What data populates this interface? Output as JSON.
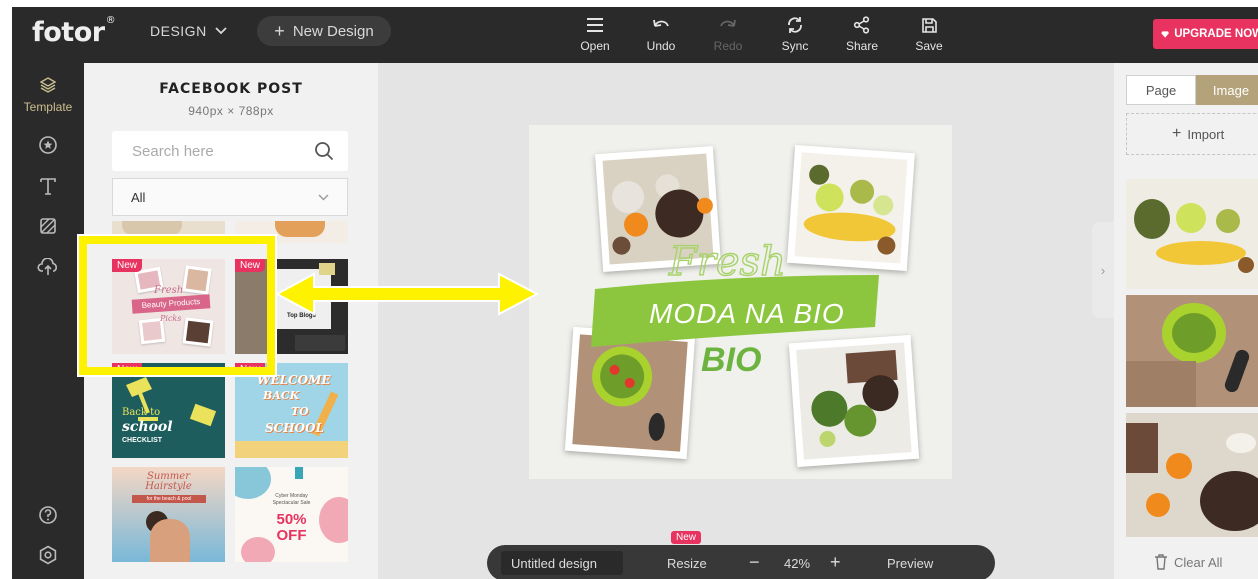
{
  "topbar": {
    "logo": "fotor",
    "logo_mark": "®",
    "design_menu": "DESIGN",
    "new_design": "New Design",
    "tools": [
      {
        "label": "Open",
        "icon": "menu-icon",
        "enabled": true
      },
      {
        "label": "Undo",
        "icon": "undo-icon",
        "enabled": true
      },
      {
        "label": "Redo",
        "icon": "redo-icon",
        "enabled": false
      },
      {
        "label": "Sync",
        "icon": "sync-icon",
        "enabled": true
      },
      {
        "label": "Share",
        "icon": "share-icon",
        "enabled": true
      },
      {
        "label": "Save",
        "icon": "save-icon",
        "enabled": true
      }
    ],
    "upgrade": "UPGRADE NOW"
  },
  "rail": {
    "items": [
      {
        "label": "Template",
        "icon": "layers-icon",
        "active": true
      },
      {
        "label": "",
        "icon": "star-badge-icon"
      },
      {
        "label": "",
        "icon": "text-icon"
      },
      {
        "label": "",
        "icon": "background-icon"
      },
      {
        "label": "",
        "icon": "cloud-upload-icon"
      }
    ],
    "bottom_icons": [
      "help-icon",
      "settings-icon"
    ]
  },
  "template_panel": {
    "title": "FACEBOOK POST",
    "size": "940px × 788px",
    "search_placeholder": "Search here",
    "filter_value": "All",
    "badge_label": "New",
    "templates": [
      {
        "text": [
          "Fresh",
          "Beauty Products",
          "Picks"
        ],
        "badge": true
      },
      {
        "text": [
          "Top Blogs"
        ],
        "badge": true
      },
      {
        "text": [
          "Back to",
          "school",
          "CHECKLIST"
        ],
        "badge": true
      },
      {
        "text": [
          "WELCOME",
          "BACK",
          "TO",
          "SCHOOL"
        ],
        "badge": true
      },
      {
        "text": [
          "Summer",
          "Hairstyle",
          "for the beach & pool"
        ],
        "badge": false
      },
      {
        "text": [
          "Cyber Monday",
          "Spectacular Sale",
          "50%",
          "OFF"
        ],
        "badge": false
      }
    ]
  },
  "canvas": {
    "script_text": "Fresh",
    "banner_text": "MODA NA BIO",
    "sub_text": "BIO"
  },
  "right_panel": {
    "tabs": [
      {
        "label": "Page",
        "active": false
      },
      {
        "label": "Image",
        "active": true
      }
    ],
    "import_label": "Import",
    "clear_label": "Clear All"
  },
  "bottombar": {
    "doc_name": "Untitled design",
    "resize": "Resize",
    "resize_badge": "New",
    "zoom": "42%",
    "preview": "Preview"
  },
  "colors": {
    "accent": "#e8325f",
    "gold": "#b4a37a",
    "highlight": "#fff200",
    "dark": "#2a2a2a"
  }
}
